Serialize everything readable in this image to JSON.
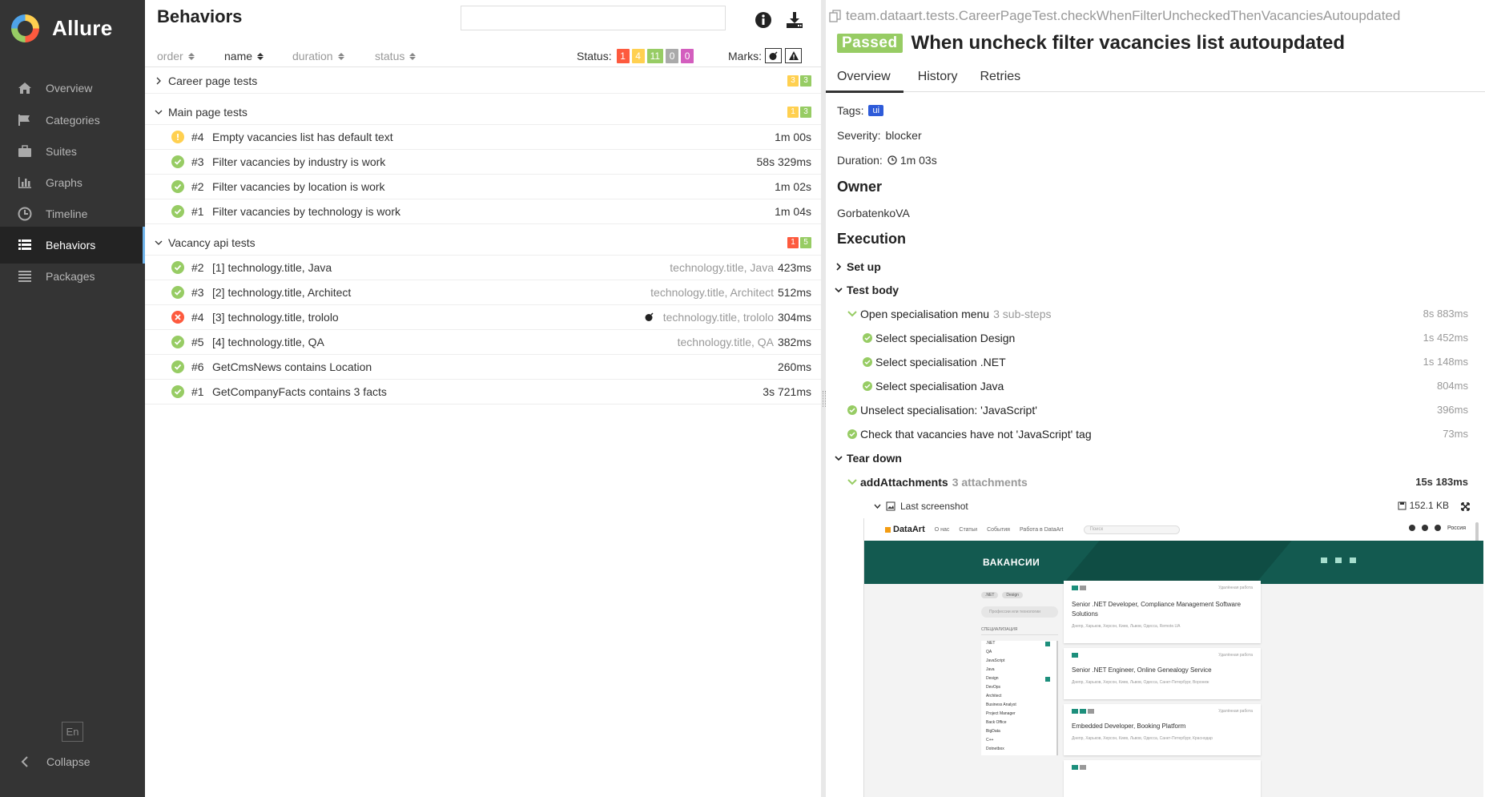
{
  "app": {
    "name": "Allure"
  },
  "sidebar": {
    "items": [
      {
        "label": "Overview",
        "icon": "home-icon"
      },
      {
        "label": "Categories",
        "icon": "flag-icon"
      },
      {
        "label": "Suites",
        "icon": "briefcase-icon"
      },
      {
        "label": "Graphs",
        "icon": "bar-chart-icon"
      },
      {
        "label": "Timeline",
        "icon": "clock-icon"
      },
      {
        "label": "Behaviors",
        "icon": "list-icon",
        "active": true
      },
      {
        "label": "Packages",
        "icon": "packages-icon"
      }
    ],
    "language": "En",
    "collapse_label": "Collapse"
  },
  "behaviors": {
    "title": "Behaviors",
    "search_value": "",
    "sort": {
      "order": "order",
      "name": "name",
      "duration": "duration",
      "status": "status",
      "active": "name"
    },
    "status_label": "Status:",
    "status_counts": {
      "failed": "1",
      "broken": "4",
      "passed": "11",
      "skipped": "0",
      "unknown": "0"
    },
    "marks_label": "Marks:",
    "groups": [
      {
        "name": "Career page tests",
        "expanded": false,
        "counts": [
          {
            "kind": "broken",
            "value": "3"
          },
          {
            "kind": "passed",
            "value": "3"
          }
        ],
        "tests": []
      },
      {
        "name": "Main page tests",
        "expanded": true,
        "counts": [
          {
            "kind": "broken",
            "value": "1"
          },
          {
            "kind": "passed",
            "value": "3"
          }
        ],
        "tests": [
          {
            "status": "broken",
            "num": "#4",
            "name": "Empty vacancies list has default text",
            "params": "",
            "duration": "1m 00s"
          },
          {
            "status": "passed",
            "num": "#3",
            "name": "Filter vacancies by industry is work",
            "params": "",
            "duration": "58s 329ms"
          },
          {
            "status": "passed",
            "num": "#2",
            "name": "Filter vacancies by location is work",
            "params": "",
            "duration": "1m 02s"
          },
          {
            "status": "passed",
            "num": "#1",
            "name": "Filter vacancies by technology is work",
            "params": "",
            "duration": "1m 04s"
          }
        ]
      },
      {
        "name": "Vacancy api tests",
        "expanded": true,
        "counts": [
          {
            "kind": "failed",
            "value": "1"
          },
          {
            "kind": "passed",
            "value": "5"
          }
        ],
        "tests": [
          {
            "status": "passed",
            "num": "#2",
            "name": "[1] technology.title, Java",
            "params": "technology.title, Java",
            "duration": "423ms"
          },
          {
            "status": "passed",
            "num": "#3",
            "name": "[2] technology.title, Architect",
            "params": "technology.title, Architect",
            "duration": "512ms"
          },
          {
            "status": "failed",
            "num": "#4",
            "name": "[3] technology.title, trololo",
            "params": "technology.title, trololo",
            "duration": "304ms",
            "flaky": true
          },
          {
            "status": "passed",
            "num": "#5",
            "name": "[4] technology.title, QA",
            "params": "technology.title, QA",
            "duration": "382ms"
          },
          {
            "status": "passed",
            "num": "#6",
            "name": "GetCmsNews contains Location",
            "params": "",
            "duration": "260ms"
          },
          {
            "status": "passed",
            "num": "#1",
            "name": "GetCompanyFacts contains 3 facts",
            "params": "",
            "duration": "3s 721ms"
          }
        ]
      }
    ]
  },
  "testcase": {
    "full_name": "team.dataart.tests.CareerPageTest.checkWhenFilterUncheckedThenVacanciesAutoupdated",
    "status": "Passed",
    "title": "When uncheck filter vacancies list autoupdated",
    "tabs": [
      "Overview",
      "History",
      "Retries"
    ],
    "tags_label": "Tags:",
    "tag": "ui",
    "severity_label": "Severity:",
    "severity": "blocker",
    "duration_label": "Duration:",
    "duration": "1m 03s",
    "owner_heading": "Owner",
    "owner": "GorbatenkoVA",
    "execution_heading": "Execution",
    "setup_label": "Set up",
    "body_label": "Test body",
    "steps": [
      {
        "name": "Open specialisation menu",
        "sub": "3 sub-steps",
        "duration": "8s 883ms"
      },
      {
        "name": "Select specialisation Design",
        "duration": "1s 452ms"
      },
      {
        "name": "Select specialisation .NET",
        "duration": "1s 148ms"
      },
      {
        "name": "Select specialisation Java",
        "duration": "804ms"
      },
      {
        "name": "Unselect specialisation: 'JavaScript'",
        "duration": "396ms"
      },
      {
        "name": "Check that vacancies have not 'JavaScript' tag",
        "duration": "73ms"
      }
    ],
    "teardown_label": "Tear down",
    "add_attachments": {
      "name": "addAttachments",
      "sub": "3 attachments",
      "duration": "15s 183ms"
    },
    "attachment": {
      "name": "Last screenshot",
      "size": "152.1 KB"
    }
  },
  "screenshot": {
    "logo": "DataArt",
    "nav": [
      "О нас",
      "Статьи",
      "События",
      "Работа в DataArt"
    ],
    "search_placeholder": "Поиск",
    "lang": "Россия",
    "banner_title": "ВАКАНСИИ",
    "filter_pills": [
      ".NET",
      "Design"
    ],
    "search_prof": "Профессии или технологии",
    "spec_heading": "СПЕЦИАЛИЗАЦИЯ",
    "specs": [
      ".NET",
      "QA",
      "JavaScript",
      "Java",
      "Design",
      "DevOps",
      "Architect",
      "Business Analyst",
      "Project Manager",
      "Back Office",
      "BigData",
      "C++",
      "Dotnetbox"
    ],
    "remote": "Удалённая работа",
    "cards": [
      {
        "title": "Senior .NET Developer, Compliance Management Software Solutions",
        "cities": "Днепр, Харьков, Херсон, Киев, Львов, Одесса, Remote.UA"
      },
      {
        "title": "Senior .NET Engineer, Online Genealogy Service",
        "cities": "Днепр, Харьков, Херсон, Киев, Львов, Одесса, Санкт-Петербург, Воронеж"
      },
      {
        "title": "Embedded Developer, Booking Platform",
        "cities": "Днепр, Харьков, Херсон, Киев, Львов, Одесса, Санкт-Петербург, Краснодар"
      }
    ]
  }
}
